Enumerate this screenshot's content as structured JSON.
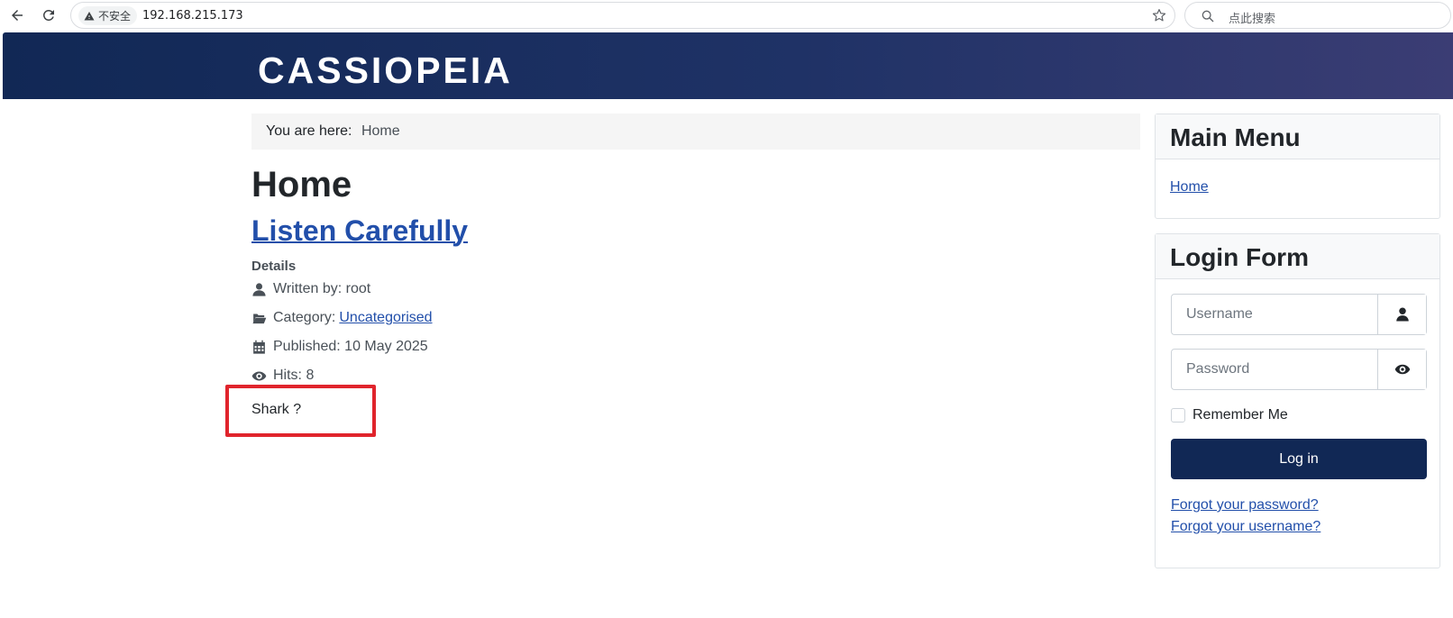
{
  "browser": {
    "security_label": "不安全",
    "url": "192.168.215.173",
    "search_placeholder": "点此搜索"
  },
  "site": {
    "brand": "CASSIOPEIA"
  },
  "breadcrumb": {
    "prefix": "You are here:",
    "current": "Home"
  },
  "page": {
    "title": "Home"
  },
  "article": {
    "title": "Listen Carefully",
    "details_heading": "Details",
    "written_by": "Written by: root",
    "category_label": "Category:",
    "category_link": "Uncategorised",
    "published": "Published: 10 May 2025",
    "hits": "Hits: 8",
    "body": "Shark ?"
  },
  "main_menu": {
    "title": "Main Menu",
    "items": [
      {
        "label": "Home"
      }
    ]
  },
  "login_form": {
    "title": "Login Form",
    "username_placeholder": "Username",
    "password_placeholder": "Password",
    "remember_label": "Remember Me",
    "login_button": "Log in",
    "forgot_password": "Forgot your password?",
    "forgot_username": "Forgot your username?"
  },
  "colors": {
    "header_start": "#112855",
    "header_end": "#3b3d74",
    "link": "#224faa",
    "highlight_box": "#e0242c"
  }
}
